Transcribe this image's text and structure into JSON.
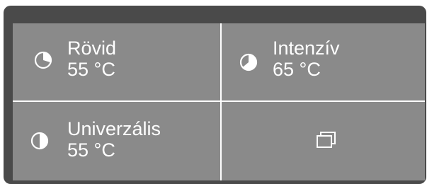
{
  "programs": [
    {
      "name": "Rövid",
      "temperature": "55 °C",
      "icon": "program-duration-icon",
      "interactable": true
    },
    {
      "name": "Intenzív",
      "temperature": "65 °C",
      "icon": "program-duration-icon",
      "interactable": true
    },
    {
      "name": "Univerzális",
      "temperature": "55 °C",
      "icon": "program-duration-icon",
      "interactable": true
    }
  ],
  "more_button": {
    "icon": "more-programs-icon"
  },
  "colors": {
    "frame": "#4a4a4a",
    "panel": "#8a8a8a",
    "text": "#ffffff",
    "divider": "#ffffff"
  }
}
